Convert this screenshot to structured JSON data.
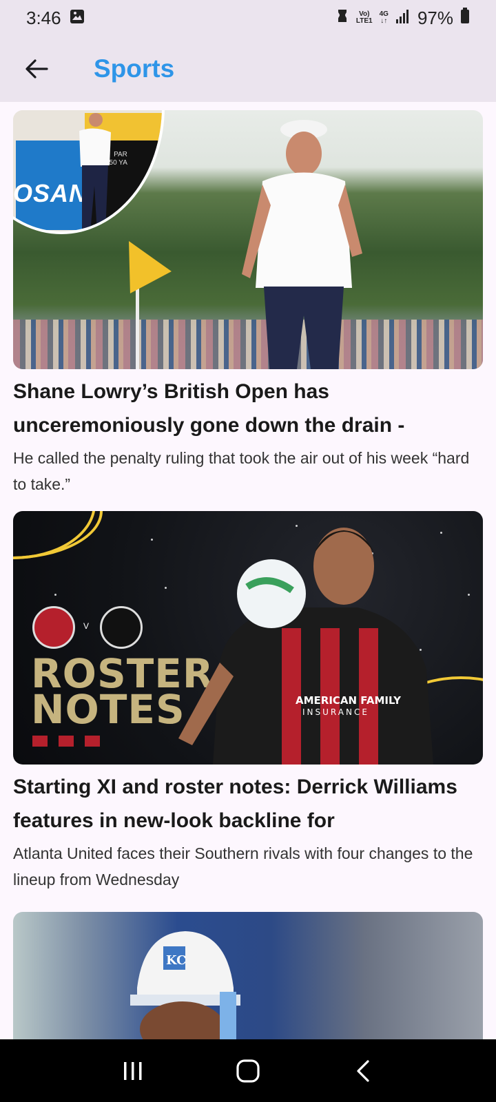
{
  "status_bar": {
    "time": "3:46",
    "network_top": "Vo)",
    "network_bottom": "LTE1",
    "net_gen": "4G",
    "battery": "97%"
  },
  "app_bar": {
    "title": "Sports"
  },
  "articles": [
    {
      "title": "Shane Lowry’s British Open has unceremoniously gone down the drain -",
      "description": "He called the penalty ruling that took the air out of his week “hard to take.”",
      "image": {
        "board_text": "OSAN",
        "par_line1": "PAR",
        "par_line2": "450 YA"
      }
    },
    {
      "title": "Starting XI and roster notes: Derrick Williams features in new-look backline for",
      "description": "Atlanta United faces their Southern rivals with four changes to the lineup from Wednesday",
      "image": {
        "headline_line1": "ROSTER",
        "headline_line2": "NOTES",
        "vs": "V",
        "sponsor_line1": "AMERICAN FAMILY",
        "sponsor_line2": "INSURANCE"
      }
    },
    {
      "title": "",
      "description": "",
      "image": {
        "helmet_logo": "KC"
      }
    }
  ],
  "nav": {
    "recents": "recents",
    "home": "home",
    "back": "back"
  }
}
